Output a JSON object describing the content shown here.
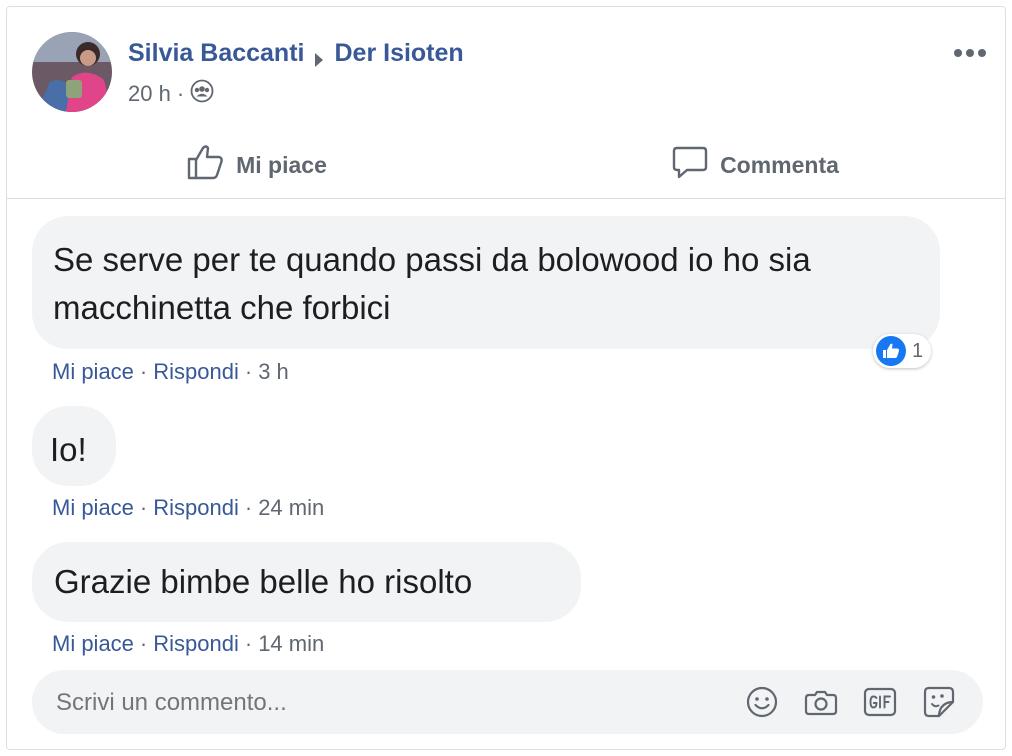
{
  "post": {
    "author": "Silvia Baccanti",
    "group": "Der Isioten",
    "time": "20 h",
    "separator": "·",
    "more_icon": "more-horizontal-icon",
    "privacy_icon": "group-icon"
  },
  "actions": {
    "like_label": "Mi piace",
    "comment_label": "Commenta"
  },
  "comments": [
    {
      "text": "Se serve per te quando passi da bolowood io ho sia macchinetta che forbici",
      "like": "Mi piace",
      "reply": "Rispondi",
      "time": "3 h",
      "reaction_count": "1"
    },
    {
      "text": "Io!",
      "like": "Mi piace",
      "reply": "Rispondi",
      "time": "24 min"
    },
    {
      "text": "Grazie bimbe belle ho risolto",
      "like": "Mi piace",
      "reply": "Rispondi",
      "time": "14 min"
    }
  ],
  "composer": {
    "placeholder": "Scrivi un commento...",
    "icons": [
      "emoji-icon",
      "camera-icon",
      "gif-icon",
      "sticker-icon"
    ]
  },
  "colors": {
    "link": "#385898",
    "muted": "#606770",
    "bubble": "#f2f3f5",
    "like_blue": "#1877f2"
  }
}
